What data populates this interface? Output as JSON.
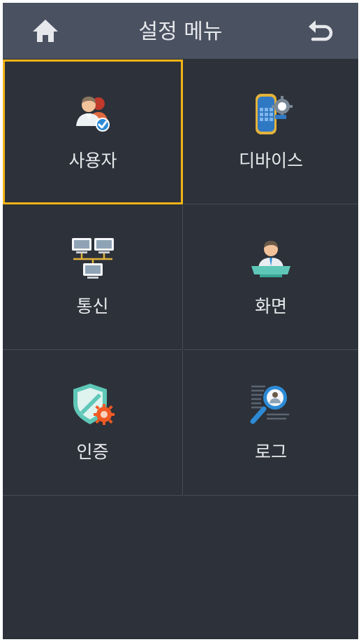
{
  "header": {
    "title": "설정 메뉴",
    "home_icon": "home-icon",
    "back_icon": "back-arrow-icon"
  },
  "colors": {
    "background": "#2d3139",
    "header": "#4a5160",
    "selection": "#f2b316"
  },
  "menu": {
    "items": [
      {
        "label": "사용자",
        "icon": "user-management-icon",
        "selected": true
      },
      {
        "label": "디바이스",
        "icon": "device-settings-icon",
        "selected": false
      },
      {
        "label": "통신",
        "icon": "network-icon",
        "selected": false
      },
      {
        "label": "화면",
        "icon": "display-icon",
        "selected": false
      },
      {
        "label": "인증",
        "icon": "authentication-shield-icon",
        "selected": false
      },
      {
        "label": "로그",
        "icon": "log-search-icon",
        "selected": false
      }
    ]
  }
}
